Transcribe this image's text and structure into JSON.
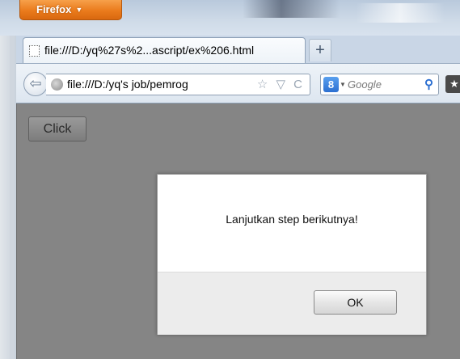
{
  "browser": {
    "menu_button_label": "Firefox",
    "tab": {
      "title": "file:///D:/yq%27s%2...ascript/ex%206.html",
      "favicon": "blank-page-icon"
    },
    "new_tab_label": "+",
    "url": "file:///D:/yq's job/pemrog",
    "url_icons": "☆ ▽ C",
    "search": {
      "engine_label": "8",
      "placeholder": "Google",
      "engine_icon": "google-icon"
    },
    "bookmark_icon_label": "★"
  },
  "page": {
    "click_button_label": "Click"
  },
  "dialog": {
    "message": "Lanjutkan step berikutnya!",
    "ok_label": "OK"
  },
  "colors": {
    "firefox_orange": "#ea7b1c",
    "page_overlay": "#858585",
    "dialog_footer": "#ececec"
  }
}
